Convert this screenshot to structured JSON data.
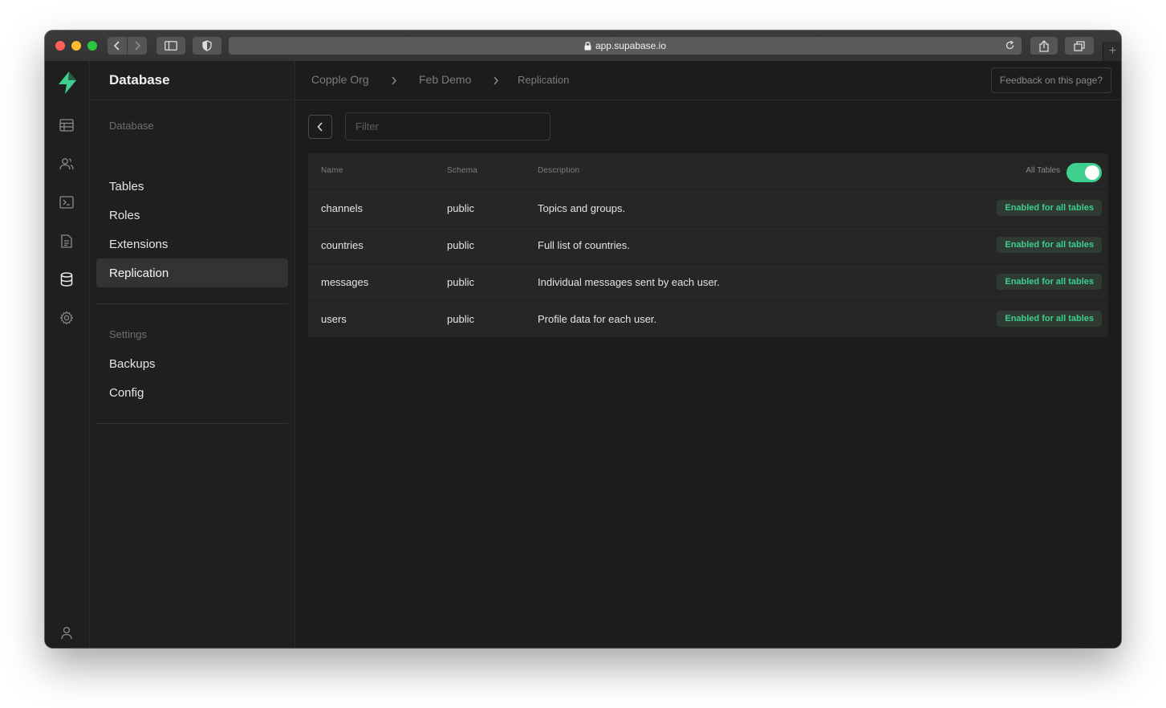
{
  "browser": {
    "url": "app.supabase.io"
  },
  "sidebar": {
    "title": "Database",
    "sections": [
      {
        "title": "Database",
        "items": [
          {
            "label": "Tables"
          },
          {
            "label": "Roles"
          },
          {
            "label": "Extensions"
          },
          {
            "label": "Replication"
          }
        ]
      },
      {
        "title": "Settings",
        "items": [
          {
            "label": "Backups"
          },
          {
            "label": "Config"
          }
        ]
      }
    ]
  },
  "breadcrumb": [
    "Copple Org",
    "Feb Demo",
    "Replication"
  ],
  "feedback_label": "Feedback on this page?",
  "filter": {
    "placeholder": "Filter",
    "value": ""
  },
  "table": {
    "columns": [
      "Name",
      "Schema",
      "Description"
    ],
    "all_tables_label": "All Tables",
    "all_tables_enabled": true,
    "rows": [
      {
        "name": "channels",
        "schema": "public",
        "description": "Topics and groups.",
        "status": "Enabled for all tables"
      },
      {
        "name": "countries",
        "schema": "public",
        "description": "Full list of countries.",
        "status": "Enabled for all tables"
      },
      {
        "name": "messages",
        "schema": "public",
        "description": "Individual messages sent by each user.",
        "status": "Enabled for all tables"
      },
      {
        "name": "users",
        "schema": "public",
        "description": "Profile data for each user.",
        "status": "Enabled for all tables"
      }
    ]
  },
  "colors": {
    "accent": "#3ecf8e",
    "background": "#1c1c1c",
    "panel": "#262626"
  },
  "icons": {
    "iconbar": [
      "supabase-logo-icon",
      "table-icon",
      "users-icon",
      "terminal-icon",
      "document-icon",
      "database-icon",
      "gear-icon",
      "user-icon"
    ]
  }
}
